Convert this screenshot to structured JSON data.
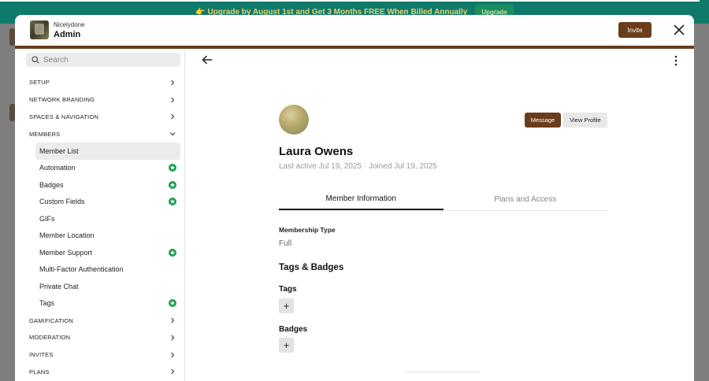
{
  "banner": {
    "message": "👉 Upgrade by August 1st and Get 3 Months FREE When Billed Annually",
    "button_label": "Upgrade"
  },
  "header": {
    "org_name": "Nicelydone",
    "section_title": "Admin",
    "invite_label": "Invite"
  },
  "sidebar": {
    "search_placeholder": "Search",
    "sections_top": [
      "SETUP",
      "NETWORK BRANDING",
      "SPACES & NAVIGATION"
    ],
    "members_label": "MEMBERS",
    "member_items": [
      {
        "label": "Member List",
        "starred": false,
        "active": true
      },
      {
        "label": "Automation",
        "starred": true
      },
      {
        "label": "Badges",
        "starred": true
      },
      {
        "label": "Custom Fields",
        "starred": true
      },
      {
        "label": "GIFs",
        "starred": false
      },
      {
        "label": "Member Location",
        "starred": false
      },
      {
        "label": "Member Support",
        "starred": true
      },
      {
        "label": "Multi-Factor Authentication",
        "starred": false
      },
      {
        "label": "Private Chat",
        "starred": false
      },
      {
        "label": "Tags",
        "starred": true
      }
    ],
    "sections_bottom": [
      "GAMIFICATION",
      "MODERATION",
      "INVITES",
      "PLANS"
    ]
  },
  "profile": {
    "name": "Laura Owens",
    "last_active": "Last active Jul 19, 2025 · Joined Jul 19, 2025",
    "message_label": "Message",
    "view_profile_label": "View Profile",
    "tabs": [
      "Member Information",
      "Plans and Access"
    ],
    "membership_type_label": "Membership Type",
    "membership_type_value": "Full",
    "tags_badges_heading": "Tags & Badges",
    "tags_label": "Tags",
    "badges_label": "Badges",
    "add_symbol": "+"
  },
  "colors": {
    "brand": "#6b3d1c",
    "banner_bg": "#0f7a6a",
    "star_green": "#1f9d55"
  }
}
